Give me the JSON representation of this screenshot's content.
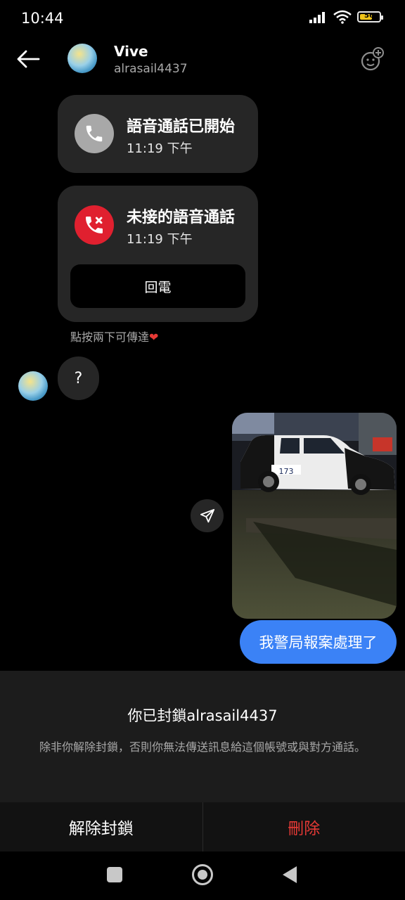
{
  "status_bar": {
    "time": "10:44",
    "battery": "56"
  },
  "header": {
    "name": "Vive",
    "username": "alrasail4437"
  },
  "call_started": {
    "title": "語音通話已開始",
    "time": "11:19 下午"
  },
  "missed_call": {
    "title": "未接的語音通話",
    "time": "11:19 下午",
    "callback_label": "回電"
  },
  "double_tap_hint": "點按兩下可傳達",
  "incoming_message": "?",
  "photo": {
    "plate": "173"
  },
  "outgoing_message": "我警局報案處理了",
  "block_notice": {
    "title": "你已封鎖alrasail4437",
    "description": "除非你解除封鎖，否則你無法傳送訊息給這個帳號或與對方通話。"
  },
  "actions": {
    "unblock_label": "解除封鎖",
    "delete_label": "刪除"
  },
  "colors": {
    "accent_blue": "#3b82f6",
    "danger_red": "#e53935",
    "card_bg": "#262626"
  },
  "icons": [
    "back-arrow-icon",
    "phone-icon",
    "missed-call-icon",
    "heart-icon",
    "send-icon",
    "effects-icon",
    "nav-recents-icon",
    "nav-home-icon",
    "nav-back-icon"
  ]
}
